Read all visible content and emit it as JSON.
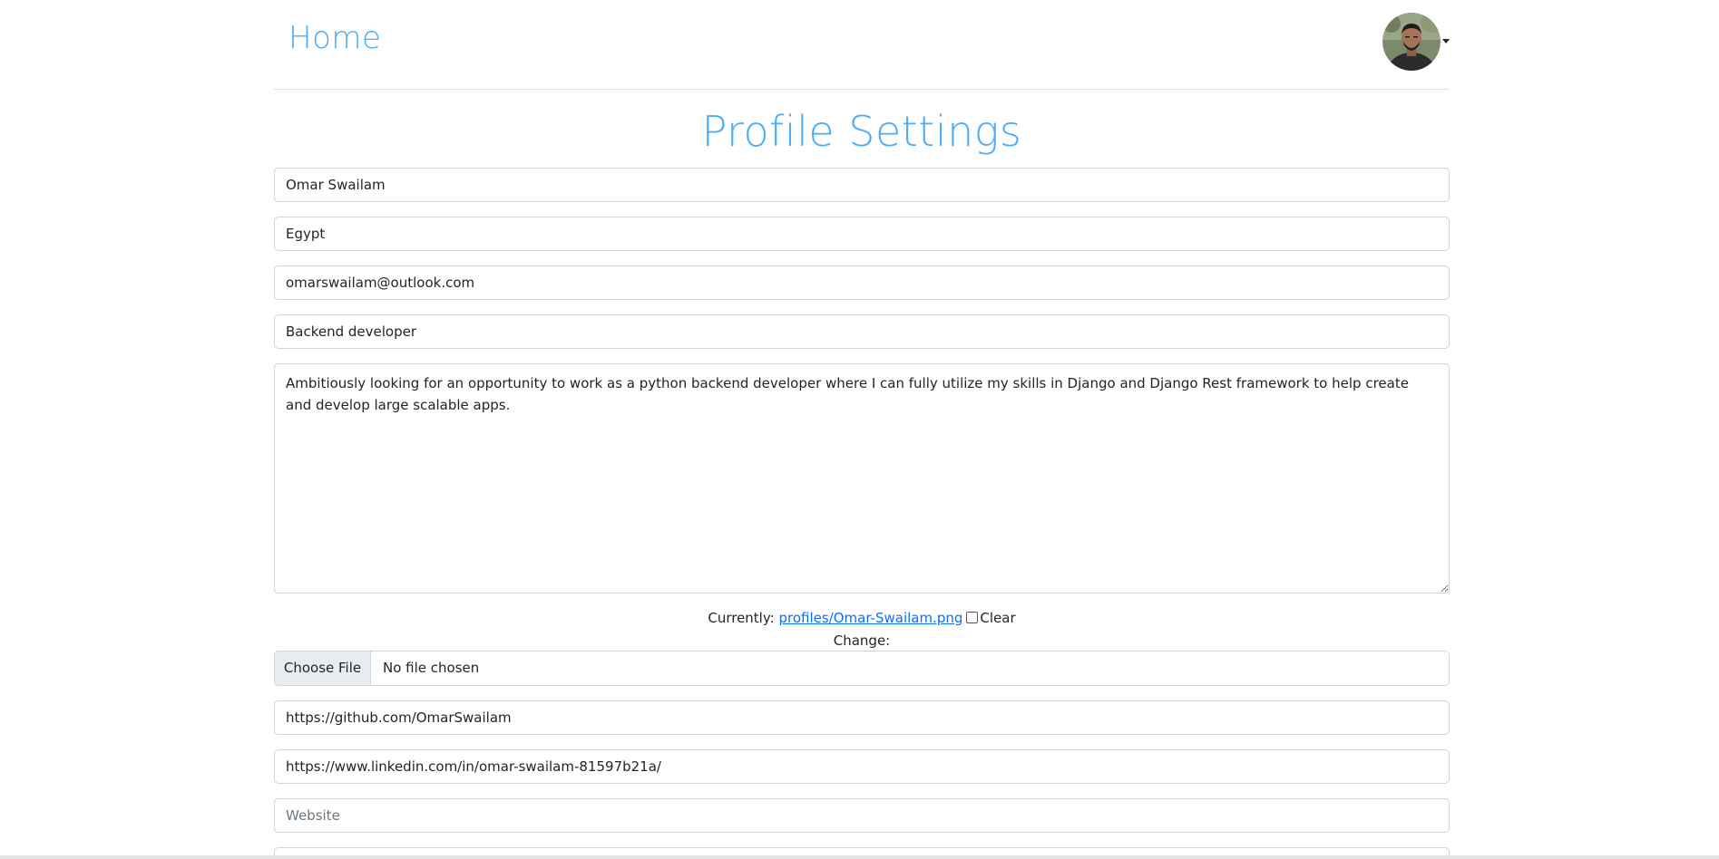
{
  "nav": {
    "brand": "Home"
  },
  "page": {
    "title": "Profile Settings"
  },
  "form": {
    "name": {
      "value": "Omar Swailam"
    },
    "location": {
      "value": "Egypt"
    },
    "email": {
      "value": "omarswailam@outlook.com"
    },
    "headline": {
      "value": "Backend developer"
    },
    "bio": {
      "value": "Ambitiously looking for an opportunity to work as a python backend developer where I can fully utilize my skills in Django and Django Rest framework to help create and develop large scalable apps."
    },
    "image": {
      "currently_label": "Currently:",
      "current_file": "profiles/Omar-Swailam.png",
      "clear_label": "Clear",
      "change_label": "Change:",
      "choose_button": "Choose File",
      "no_file": "No file chosen"
    },
    "github": {
      "value": "https://github.com/OmarSwailam"
    },
    "linkedin": {
      "value": "https://www.linkedin.com/in/omar-swailam-81597b21a/"
    },
    "website": {
      "value": "",
      "placeholder": "Website"
    },
    "extra": {
      "value": ""
    }
  },
  "colors": {
    "accent": "#4dabf7",
    "link": "#0d6efd",
    "border": "#ced4da"
  },
  "icons": {
    "avatar": "user-avatar-photo",
    "caret": "chevron-down-icon"
  }
}
